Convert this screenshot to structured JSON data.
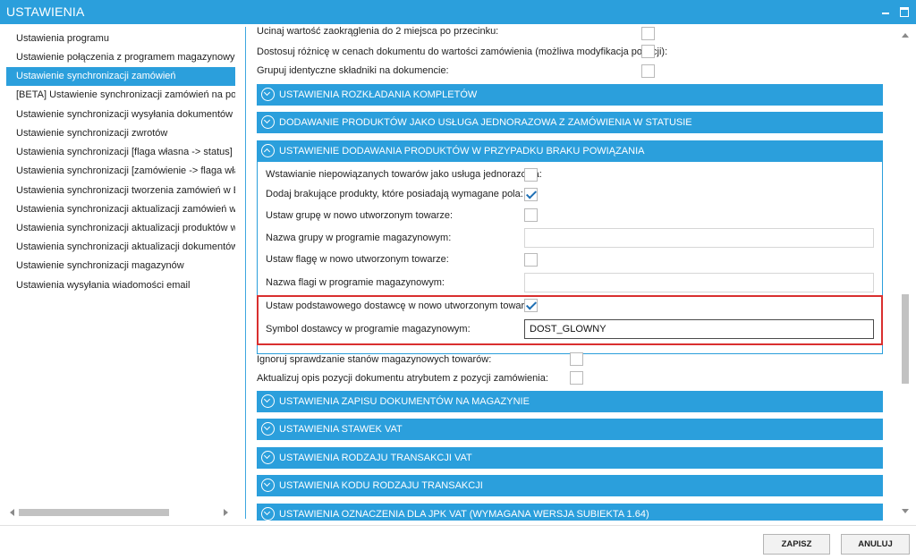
{
  "window": {
    "title": "USTAWIENIA",
    "accent_color": "#2b9fdc",
    "highlight_color": "#d92f2f"
  },
  "nav": {
    "items": [
      {
        "label": "Ustawienia programu"
      },
      {
        "label": "Ustawienie połączenia z programem magazynowym"
      },
      {
        "label": "Ustawienie synchronizacji zamówień"
      },
      {
        "label": "[BETA] Ustawienie synchronizacji zamówień na podsta"
      },
      {
        "label": "Ustawienie synchronizacji wysyłania dokumentów"
      },
      {
        "label": "Ustawienie synchronizacji zwrotów"
      },
      {
        "label": "Ustawienia synchronizacji [flaga własna -> status]"
      },
      {
        "label": "Ustawienia synchronizacji [zamówienie -> flaga własn"
      },
      {
        "label": "Ustawienia synchronizacji tworzenia zamówień w Base"
      },
      {
        "label": "Ustawienia synchronizacji aktualizacji zamówień w Bas"
      },
      {
        "label": "Ustawienia synchronizacji aktualizacji produktów w Ba"
      },
      {
        "label": "Ustawienia synchronizacji aktualizacji dokumentów"
      },
      {
        "label": "Ustawienie synchronizacji magazynów"
      },
      {
        "label": "Ustawienia wysyłania wiadomości email"
      }
    ],
    "active_index": 2
  },
  "content": {
    "top_rows": [
      {
        "label": "Ucinaj wartość zaokrąglenia do 2 miejsca po przecinku:",
        "checked": false
      },
      {
        "label": "Dostosuj różnicę w cenach dokumentu do wartości zamówienia (możliwa modyfikacja pozycji):",
        "checked": false
      },
      {
        "label": "Grupuj identyczne składniki na dokumencie:",
        "checked": false
      }
    ],
    "sections_collapsed_top": [
      {
        "label": "USTAWIENIA ROZKŁADANIA KOMPLETÓW"
      },
      {
        "label": "DODAWANIE PRODUKTÓW JAKO USŁUGA JEDNORAZOWA Z ZAMÓWIENIA W STATUSIE"
      }
    ],
    "expanded_section": {
      "label": "USTAWIENIE DODAWANIA PRODUKTÓW W PRZYPADKU BRAKU POWIĄZANIA",
      "rows": [
        {
          "label": "Wstawianie niepowiązanych towarów jako usługa jednorazowa:",
          "checked": false
        },
        {
          "label": "Dodaj brakujące produkty, które posiadają wymagane pola:",
          "checked": true
        },
        {
          "label": "Ustaw grupę w nowo utworzonym towarze:",
          "checked": false
        },
        {
          "label": "Nazwa grupy w programie magazynowym:",
          "value": ""
        },
        {
          "label": "Ustaw flagę w nowo utworzonym towarze:",
          "checked": false
        },
        {
          "label": "Nazwa flagi w programie magazynowym:",
          "value": ""
        },
        {
          "label": "Ustaw podstawowego dostawcę w nowo utworzonym towarze:",
          "checked": true
        },
        {
          "label": "Symbol dostawcy w programie magazynowym:",
          "value": "DOST_GLOWNY"
        }
      ]
    },
    "after_rows": [
      {
        "label": "Ignoruj sprawdzanie stanów magazynowych towarów:",
        "checked": false
      },
      {
        "label": "Aktualizuj opis pozycji dokumentu atrybutem z pozycji zamówienia:",
        "checked": false
      }
    ],
    "sections_collapsed_bottom": [
      {
        "label": "USTAWIENIA ZAPISU DOKUMENTÓW NA MAGAZYNIE"
      },
      {
        "label": "USTAWIENIA STAWEK VAT"
      },
      {
        "label": "USTAWIENIA RODZAJU TRANSAKCJI VAT"
      },
      {
        "label": "USTAWIENIA KODU RODZAJU TRANSAKCJI"
      },
      {
        "label": "USTAWIENIA OZNACZENIA DLA JPK VAT (WYMAGANA WERSJA SUBIEKTA 1.64)"
      }
    ]
  },
  "footer": {
    "save_label": "ZAPISZ",
    "cancel_label": "ANULUJ"
  }
}
